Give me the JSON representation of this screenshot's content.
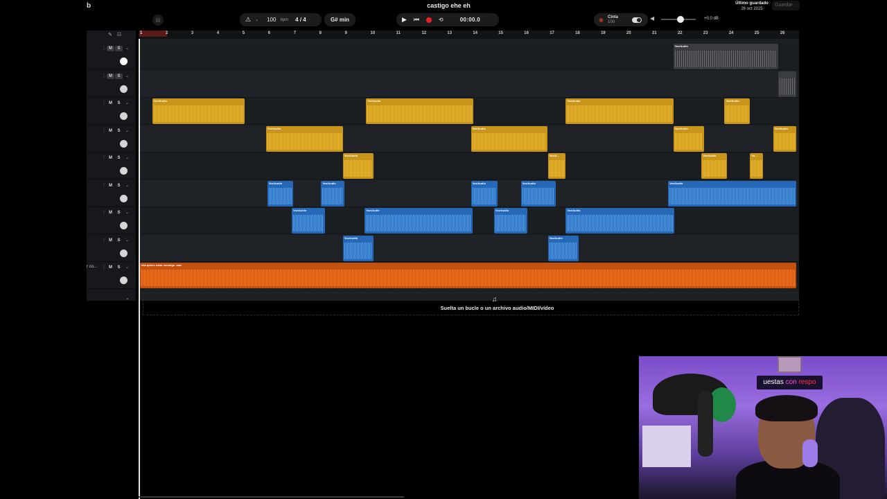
{
  "window": {
    "corner_label": "b",
    "project_title": "castigo ehe eh",
    "last_saved_label": "Último guardado",
    "last_saved_date": "26 oct 2025",
    "save_button": "Guardar"
  },
  "toolbar": {
    "tempo_value": "100",
    "tempo_unit": "bpm",
    "time_signature": "4 / 4",
    "key": "G# min",
    "time_display": "00:00.0",
    "tape_label": "Cinta",
    "tape_value": "100",
    "master_gain": "+0.0 dB",
    "volume_level": 0.55
  },
  "ruler": {
    "bars": [
      "1",
      "2",
      "3",
      "4",
      "5",
      "6",
      "7",
      "8",
      "9",
      "10",
      "11",
      "12",
      "13",
      "14",
      "15",
      "16",
      "17",
      "18",
      "19",
      "20",
      "21",
      "22",
      "23",
      "24",
      "25",
      "26"
    ]
  },
  "tracks": [
    {
      "mute": "M",
      "solo": "S",
      "name": ""
    },
    {
      "mute": "M",
      "solo": "S",
      "name": ""
    },
    {
      "mute": "M",
      "solo": "S",
      "name": ""
    },
    {
      "mute": "M",
      "solo": "S",
      "name": ""
    },
    {
      "mute": "M",
      "solo": "S",
      "name": ""
    },
    {
      "mute": "M",
      "solo": "S",
      "name": ""
    },
    {
      "mute": "M",
      "solo": "S",
      "name": ""
    },
    {
      "mute": "M",
      "solo": "S",
      "name": ""
    },
    {
      "mute": "M",
      "solo": "S",
      "name": "r co..."
    }
  ],
  "clip_labels": {
    "voz": "Voz/Audio",
    "voz_short": "Voz/A...",
    "beat": "ella quiere estar conmigo .wav"
  },
  "clips": [
    {
      "lane": 0,
      "color": "grey",
      "start_bar": 21.8,
      "end_bar": 25.9,
      "label": "Voz/Audio"
    },
    {
      "lane": 1,
      "color": "grey",
      "start_bar": 25.9,
      "end_bar": 26.6,
      "label": ""
    },
    {
      "lane": 2,
      "color": "yellow",
      "start_bar": 1.45,
      "end_bar": 5.05,
      "label": "Voz/Audio"
    },
    {
      "lane": 2,
      "color": "yellow",
      "start_bar": 9.8,
      "end_bar": 14.0,
      "label": "Voz/Audio"
    },
    {
      "lane": 2,
      "color": "yellow",
      "start_bar": 17.6,
      "end_bar": 21.8,
      "label": "Voz/Audio"
    },
    {
      "lane": 2,
      "color": "yellow",
      "start_bar": 23.8,
      "end_bar": 24.8,
      "label": "Voz/Audio"
    },
    {
      "lane": 3,
      "color": "yellow",
      "start_bar": 5.9,
      "end_bar": 8.9,
      "label": "Voz/Audio"
    },
    {
      "lane": 3,
      "color": "yellow",
      "start_bar": 13.9,
      "end_bar": 16.9,
      "label": "Voz/Audio"
    },
    {
      "lane": 3,
      "color": "yellow",
      "start_bar": 21.8,
      "end_bar": 23.0,
      "label": "Voz/Audio"
    },
    {
      "lane": 3,
      "color": "yellow",
      "start_bar": 25.7,
      "end_bar": 26.6,
      "label": "Voz/Audio"
    },
    {
      "lane": 4,
      "color": "yellow",
      "start_bar": 8.9,
      "end_bar": 10.1,
      "label": "Voz/Audio"
    },
    {
      "lane": 4,
      "color": "yellow",
      "start_bar": 16.9,
      "end_bar": 17.6,
      "label": "Voz/A..."
    },
    {
      "lane": 4,
      "color": "yellow",
      "start_bar": 22.9,
      "end_bar": 23.9,
      "label": "Voz/Audio"
    },
    {
      "lane": 4,
      "color": "yellow",
      "start_bar": 24.8,
      "end_bar": 25.3,
      "label": "Vo..."
    },
    {
      "lane": 5,
      "color": "blue",
      "start_bar": 5.95,
      "end_bar": 6.95,
      "label": "Voz/Audio"
    },
    {
      "lane": 5,
      "color": "blue",
      "start_bar": 8.05,
      "end_bar": 8.95,
      "label": "Voz/Audio"
    },
    {
      "lane": 5,
      "color": "blue",
      "start_bar": 13.9,
      "end_bar": 14.95,
      "label": "Voz/Audio"
    },
    {
      "lane": 5,
      "color": "blue",
      "start_bar": 15.85,
      "end_bar": 17.2,
      "label": "Voz/Audio"
    },
    {
      "lane": 5,
      "color": "blue",
      "start_bar": 21.6,
      "end_bar": 26.6,
      "label": "Voz/Audio"
    },
    {
      "lane": 6,
      "color": "blue",
      "start_bar": 6.9,
      "end_bar": 8.2,
      "label": "Voz/Audio"
    },
    {
      "lane": 6,
      "color": "blue",
      "start_bar": 9.75,
      "end_bar": 13.95,
      "label": "Voz/Audio"
    },
    {
      "lane": 6,
      "color": "blue",
      "start_bar": 14.8,
      "end_bar": 16.1,
      "label": "Voz/Audio"
    },
    {
      "lane": 6,
      "color": "blue",
      "start_bar": 17.6,
      "end_bar": 21.85,
      "label": "Voz/Audio"
    },
    {
      "lane": 7,
      "color": "blue",
      "start_bar": 8.9,
      "end_bar": 10.1,
      "label": "Voz/Audio"
    },
    {
      "lane": 7,
      "color": "blue",
      "start_bar": 16.9,
      "end_bar": 18.1,
      "label": "Voz/Audio"
    },
    {
      "lane": 8,
      "color": "orange",
      "start_bar": 1.0,
      "end_bar": 26.6,
      "label": "ella quiere estar conmigo .wav"
    }
  ],
  "dropzone": {
    "text": "Suelta un bucle o un archivo audio/MIDI/vídeo",
    "icon": "music-note-add-icon"
  },
  "colors": {
    "yellow": "#c8941a",
    "blue": "#2668b8",
    "orange": "#c4500e",
    "record": "#e52222"
  },
  "webcam": {
    "sign_text_a": "uestas ",
    "sign_text_b": "con ",
    "sign_text_c": "respo"
  }
}
